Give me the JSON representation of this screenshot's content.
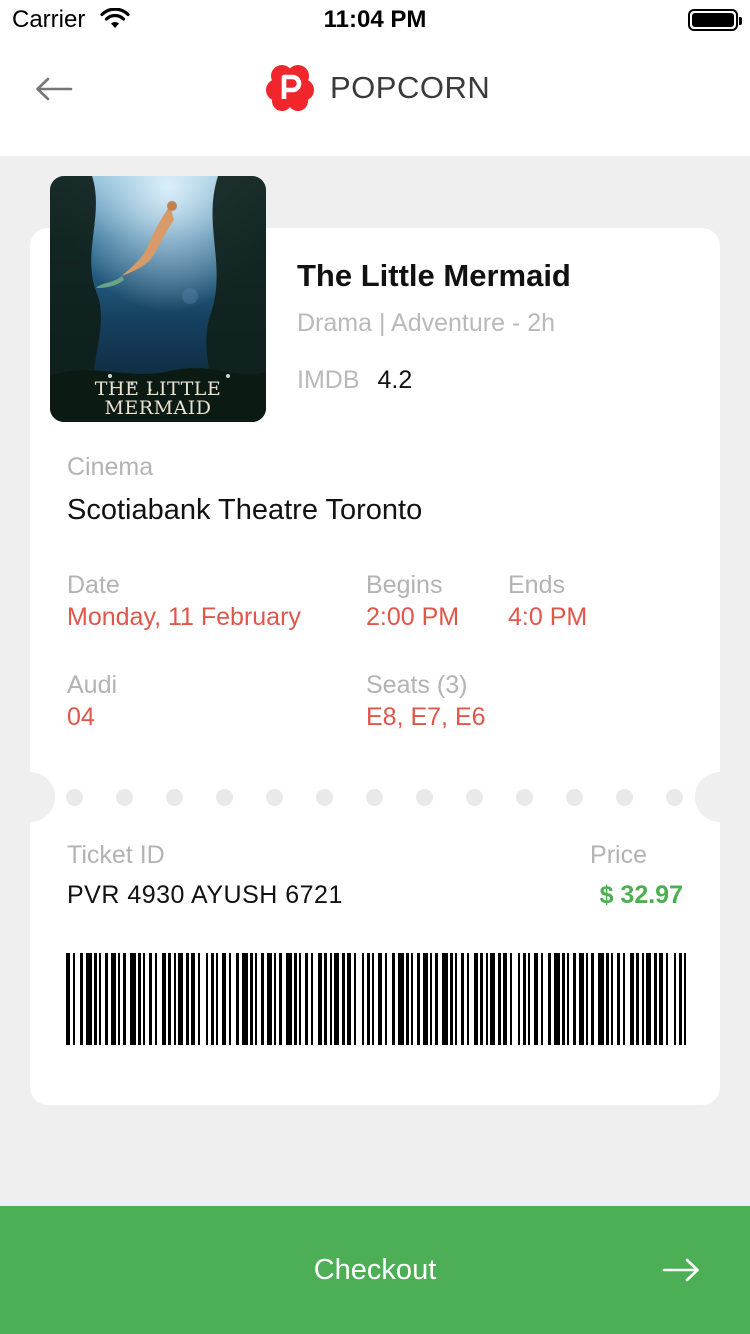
{
  "status_bar": {
    "carrier": "Carrier",
    "time": "11:04 PM"
  },
  "header": {
    "brand_name": "POPCORN",
    "brand_color": "#f0262c",
    "back_icon": "arrow-left-icon"
  },
  "movie": {
    "title": "The Little Mermaid",
    "genre": "Drama | Adventure - 2h",
    "imdb_label": "IMDB",
    "imdb_rating": "4.2",
    "poster_title_line1": "THE LITTLE",
    "poster_title_line2": "MERMAID"
  },
  "ticket": {
    "cinema_label": "Cinema",
    "cinema_name": "Scotiabank Theatre Toronto",
    "date_label": "Date",
    "date_value": "Monday, 11 February",
    "begins_label": "Begins",
    "begins_value": "2:00 PM",
    "ends_label": "Ends",
    "ends_value": "4:0 PM",
    "audi_label": "Audi",
    "audi_value": "04",
    "seats_label": "Seats (3)",
    "seats_value": "E8, E7, E6",
    "ticket_id_label": "Ticket ID",
    "ticket_id_value": "PVR 4930 AYUSH 6721",
    "price_label": "Price",
    "price_value": "$ 32.97"
  },
  "checkout": {
    "label": "Checkout",
    "icon": "arrow-right-icon",
    "color": "#4caf55"
  },
  "colors": {
    "accent_red": "#e0564a",
    "price_green": "#4caf50",
    "background": "#efefef"
  }
}
